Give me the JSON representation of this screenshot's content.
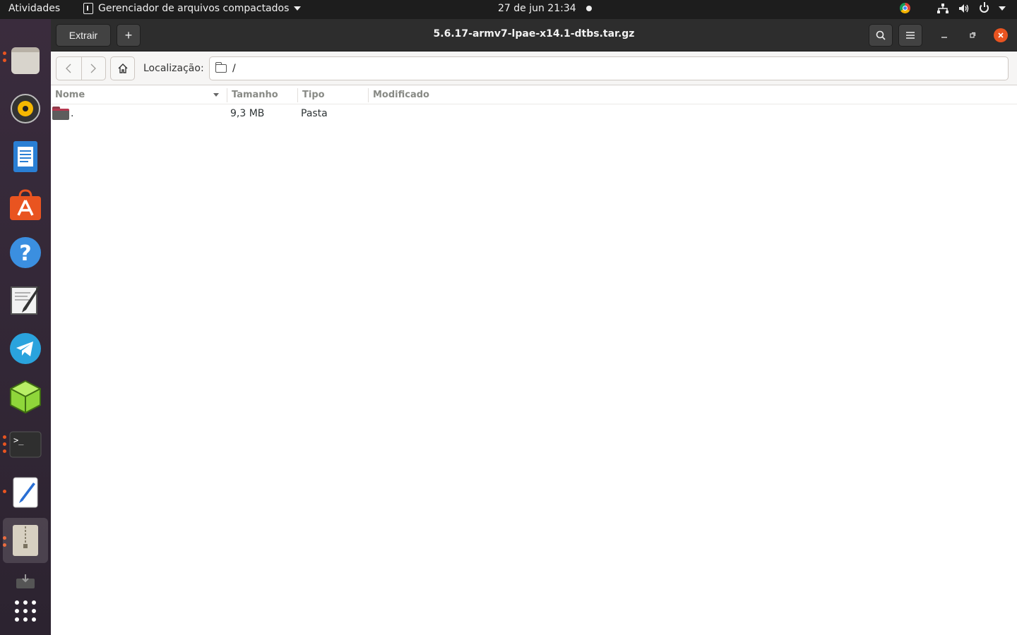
{
  "topbar": {
    "activities": "Atividades",
    "app_menu_label": "Gerenciador de arquivos compactados",
    "clock": "27 de jun  21:34"
  },
  "window": {
    "title": "5.6.17-armv7-lpae-x14.1-dtbs.tar.gz",
    "extract_label": "Extrair",
    "add_label": "+"
  },
  "toolbar": {
    "location_label": "Localização:",
    "location_value": "/"
  },
  "columns": {
    "name": "Nome",
    "size": "Tamanho",
    "type": "Tipo",
    "modified": "Modificado"
  },
  "files": [
    {
      "name": ".",
      "size": "9,3 MB",
      "type": "Pasta",
      "modified": ""
    }
  ],
  "dock": [
    "files-icon",
    "rhythmbox-icon",
    "writer-icon",
    "software-icon",
    "help-icon",
    "text-editor-icon",
    "telegram-icon",
    "cube-app-icon",
    "terminal-icon",
    "gedit-icon",
    "archive-manager-icon",
    "disk-icon",
    "app-grid-icon"
  ],
  "colors": {
    "accent": "#e95420",
    "headerbar": "#2d2d2d",
    "topbar": "#1d1d1d"
  }
}
